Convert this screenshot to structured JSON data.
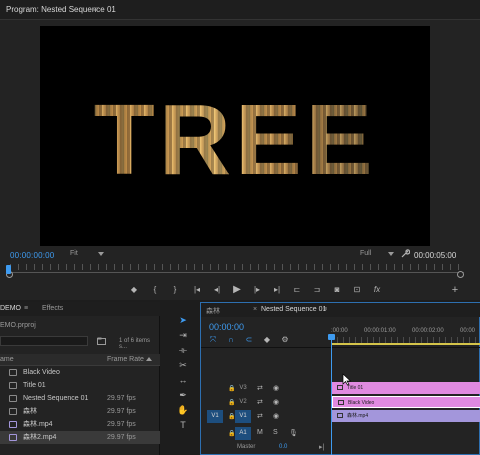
{
  "program_monitor": {
    "title": "Program: Nested Sequence 01",
    "menu_icon": "hamburger-menu-icon",
    "viewer_text": "TREE",
    "timecode_current": "00:00:00:00",
    "fit_label": "Fit",
    "quality_label": "Full",
    "timecode_duration": "00:00:05:00",
    "transport_icons": [
      "marker-icon",
      "in-point-icon",
      "out-point-icon",
      "go-to-in-icon",
      "step-back-icon",
      "play-icon",
      "step-forward-icon",
      "go-to-out-icon",
      "insert-icon",
      "overwrite-icon",
      "lift-icon",
      "extract-icon",
      "export-frame-icon",
      "comparison-icon",
      "fx-icon",
      "add-button-icon"
    ],
    "fx_label": "fx",
    "add_label": "+"
  },
  "project_panel": {
    "tab_demo": "DEMO",
    "tab_menu": "≡",
    "tab_effects": "Effects",
    "file_name": "EMO.prproj",
    "item_count": "1 of 6 items s...",
    "col_name": "ame",
    "col_frame_rate": "Frame Rate",
    "items": [
      {
        "name": "Black Video",
        "rate": "",
        "icon": "video-item-icon"
      },
      {
        "name": "Title 01",
        "rate": "",
        "icon": "title-item-icon"
      },
      {
        "name": "Nested Sequence 01",
        "rate": "29.97 fps",
        "icon": "sequence-item-icon"
      },
      {
        "name": "森林",
        "rate": "29.97 fps",
        "icon": "sequence-item-icon"
      },
      {
        "name": "森林.mp4",
        "rate": "29.97 fps",
        "icon": "clip-item-icon"
      },
      {
        "name": "森林2.mp4",
        "rate": "29.97 fps",
        "icon": "clip-item-icon"
      }
    ]
  },
  "tools": [
    "selection-tool-icon",
    "track-select-tool-icon",
    "ripple-edit-tool-icon",
    "razor-tool-icon",
    "slip-tool-icon",
    "pen-tool-icon",
    "hand-tool-icon",
    "type-tool-icon"
  ],
  "timeline": {
    "close_label": "森林",
    "tab_menu": "≡",
    "tab_close": "×",
    "sequence_name": "Nested Sequence 01",
    "timecode": "00:00:00",
    "ruler_labels": [
      ":00:00",
      "00:00:01:00",
      "00:00:02:00",
      "00:00"
    ],
    "tracks": [
      {
        "src": "",
        "target": "V3",
        "target_on": false,
        "clip": "Title 01",
        "clip_color": "#e08ae0"
      },
      {
        "src": "",
        "target": "V2",
        "target_on": false,
        "clip": "Black Video",
        "clip_color": "#e08ae0"
      },
      {
        "src": "V1",
        "target": "V1",
        "target_on": true,
        "clip": "森林.mp4",
        "clip_color": "#a396db"
      },
      {
        "src": "",
        "target": "A1",
        "target_on": true,
        "clip": "",
        "clip_color": ""
      }
    ],
    "master_label": "Master",
    "master_value": "0.0"
  },
  "colors": {
    "accent": "#3e9bf0",
    "work_area": "#d4c44a",
    "title_clip": "#e08ae0",
    "video_clip": "#a396db"
  }
}
